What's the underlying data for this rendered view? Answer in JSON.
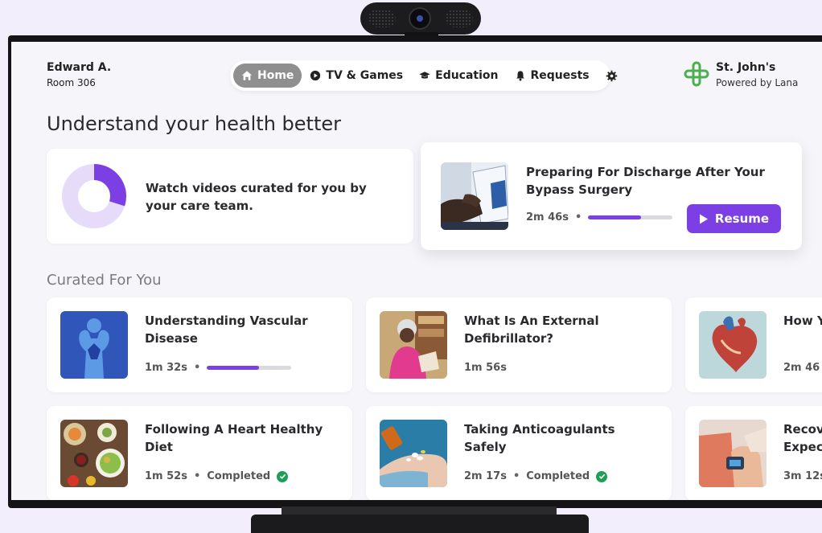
{
  "patient": {
    "name": "Edward A.",
    "room": "Room 306"
  },
  "nav": {
    "items": [
      {
        "label": "Home",
        "icon": "home-icon",
        "active": true
      },
      {
        "label": "TV & Games",
        "icon": "play-icon",
        "active": false
      },
      {
        "label": "Education",
        "icon": "graduation-cap-icon",
        "active": false
      },
      {
        "label": "Requests",
        "icon": "bell-icon",
        "active": false
      }
    ],
    "settings_icon": "gear-icon"
  },
  "brand": {
    "name": "St. John's",
    "powered": "Powered by Lana"
  },
  "headline": "Understand your health better",
  "intro": {
    "text": "Watch videos curated for you by your care team.",
    "progress": 0.3
  },
  "resume": {
    "title": "Preparing For Discharge After Your Bypass Surgery",
    "duration": "2m 46s",
    "progress": 0.63,
    "button": "Resume"
  },
  "section_title": "Curated For You",
  "videos": [
    {
      "title": "Understanding Vascular Disease",
      "duration": "1m 32s",
      "progress": 0.62,
      "completed": false
    },
    {
      "title": "What Is An External Defibrillator?",
      "duration": "1m 56s",
      "completed": false
    },
    {
      "title": "How Y",
      "duration": "2m 46",
      "completed": false
    },
    {
      "title": "Following A Heart Healthy Diet",
      "duration": "1m 52s",
      "status": "Completed",
      "completed": true
    },
    {
      "title": "Taking Anticoagulants Safely",
      "duration": "2m 17s",
      "status": "Completed",
      "completed": true
    },
    {
      "title": "Recov Expec",
      "duration": "3m 12s",
      "completed": false
    }
  ],
  "colors": {
    "accent": "#7b3fe4",
    "completed": "#1e9e58",
    "brand": "#4caf50"
  }
}
